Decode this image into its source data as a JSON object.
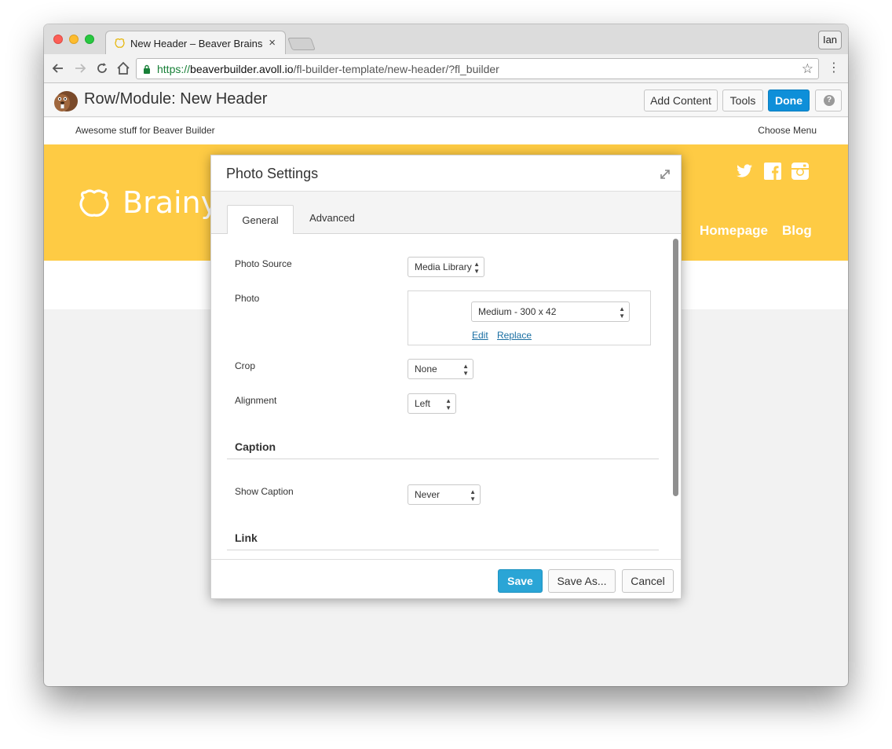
{
  "browser": {
    "tab_title": "New Header – Beaver Brains",
    "tab_close": "×",
    "profile_label": "Ian",
    "url": {
      "scheme": "https://",
      "host": "beaverbuilder.avoll.io",
      "path": "/fl-builder-template/new-header/?fl_builder"
    },
    "icons": {
      "back": "arrow-left-icon",
      "forward": "arrow-right-icon",
      "reload": "reload-icon",
      "home": "home-icon",
      "lock": "lock-icon",
      "bookmark": "star-icon",
      "menu": "kebab-menu-icon"
    }
  },
  "builder_bar": {
    "title": "Row/Module: New Header",
    "add_content_label": "Add Content",
    "tools_label": "Tools",
    "done_label": "Done",
    "help_label": "?",
    "accent_color": "#0e8fd9"
  },
  "site": {
    "tagline": "Awesome stuff for Beaver Builder",
    "choose_menu": "Choose Menu",
    "brand_name": "Brainy",
    "header_color": "#fecb44",
    "nav": [
      "Homepage",
      "Blog"
    ],
    "social_icons": [
      "twitter-icon",
      "facebook-icon",
      "instagram-icon"
    ]
  },
  "modal": {
    "title": "Photo Settings",
    "tabs": [
      {
        "label": "General",
        "active": true
      },
      {
        "label": "Advanced",
        "active": false
      }
    ],
    "fields": {
      "photo_source": {
        "label": "Photo Source",
        "value": "Media Library"
      },
      "photo": {
        "label": "Photo",
        "size_value": "Medium - 300 x 42",
        "edit_label": "Edit",
        "replace_label": "Replace"
      },
      "crop": {
        "label": "Crop",
        "value": "None"
      },
      "alignment": {
        "label": "Alignment",
        "value": "Left"
      }
    },
    "sections": {
      "caption": {
        "title": "Caption",
        "show_caption_label": "Show Caption",
        "show_caption_value": "Never"
      },
      "link": {
        "title": "Link"
      }
    },
    "footer": {
      "save_label": "Save",
      "save_as_label": "Save As...",
      "cancel_label": "Cancel"
    }
  }
}
